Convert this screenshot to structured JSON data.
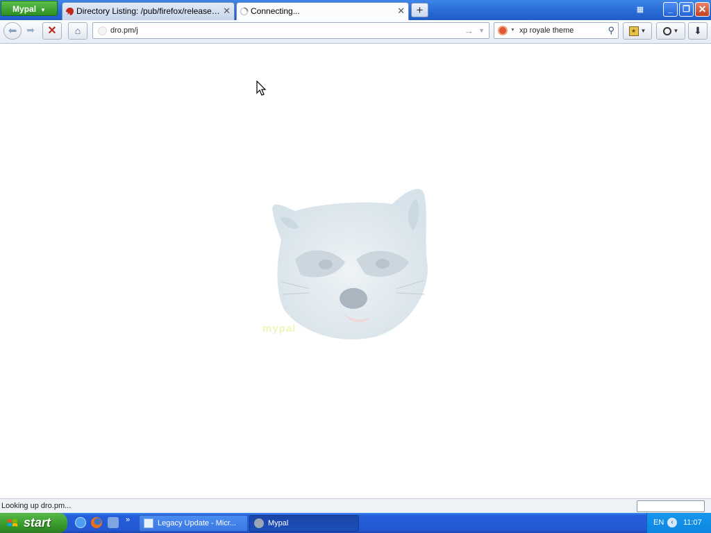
{
  "browser": {
    "app_button_label": "Mypal",
    "tabs": [
      {
        "label": "Directory Listing: /pub/firefox/releases/4...",
        "icon": "firefox-ftp-favicon",
        "active": false
      },
      {
        "label": "Connecting...",
        "icon": "loading-spinner-icon",
        "active": true
      }
    ],
    "new_tab_label": "+",
    "window_controls": {
      "minimize": "_",
      "maximize": "❐",
      "close": "✕"
    }
  },
  "navbar": {
    "url": "dro.pm/j",
    "search_text": "xp royale theme",
    "search_engine": "duckduckgo-icon"
  },
  "content": {
    "logo": "mypal-raccoon-logo",
    "watermark_text": "mypal"
  },
  "statusbar": {
    "text": "Looking up dro.pm..."
  },
  "taskbar": {
    "start_label": "start",
    "quick_launch_more": "»",
    "tasks": [
      {
        "label": "Legacy Update - Micr...",
        "icon": "ie-document-icon",
        "active": false
      },
      {
        "label": "Mypal",
        "icon": "mypal-icon",
        "active": true
      }
    ],
    "language": "EN",
    "clock": "11:07"
  },
  "colors": {
    "taskbar_blue": "#245edb",
    "start_green": "#389a2a",
    "titlebar_blue": "#2a6fd8",
    "tray_blue": "#0d86df"
  }
}
